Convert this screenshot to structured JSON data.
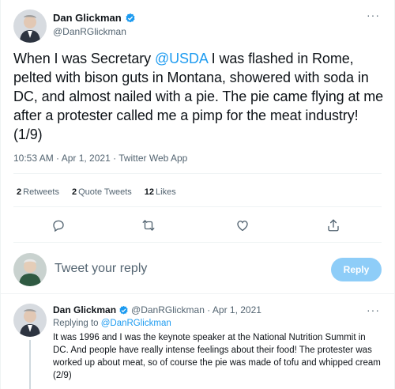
{
  "main_tweet": {
    "author_name": "Dan Glickman",
    "author_handle": "@DanRGlickman",
    "more_label": "···",
    "text_before_mention": "When I was Secretary ",
    "mention": "@USDA",
    "text_after_mention": " I was flashed in Rome, pelted with bison guts in Montana, showered with soda in DC, and almost nailed with a pie. The pie came flying at me after a protester called me a pimp for the meat industry! (1/9)",
    "meta": "10:53 AM · Apr 1, 2021 · Twitter Web App"
  },
  "stats": {
    "retweets_count": "2",
    "retweets_label": "Retweets",
    "quotes_count": "2",
    "quotes_label": "Quote Tweets",
    "likes_count": "12",
    "likes_label": "Likes"
  },
  "actions": {
    "icons": [
      "reply-icon",
      "retweet-icon",
      "like-icon",
      "share-icon"
    ]
  },
  "composer": {
    "placeholder": "Tweet your reply",
    "reply_label": "Reply"
  },
  "thread_tweet": {
    "author_name": "Dan Glickman",
    "meta": "@DanRGlickman · Apr 1, 2021",
    "more_label": "···",
    "replying_prefix": "Replying to ",
    "replying_handle": "@DanRGlickman",
    "text": "It was 1996 and I was the keynote speaker at the National Nutrition Summit in DC. And people have really intense feelings about their food! The protester was worked up about meat, so of course the pie was made of tofu and whipped cream (2/9)"
  },
  "colors": {
    "accent": "#1d9bf0",
    "reply_button_disabled": "#8ecdf8",
    "secondary_text": "#536471"
  }
}
